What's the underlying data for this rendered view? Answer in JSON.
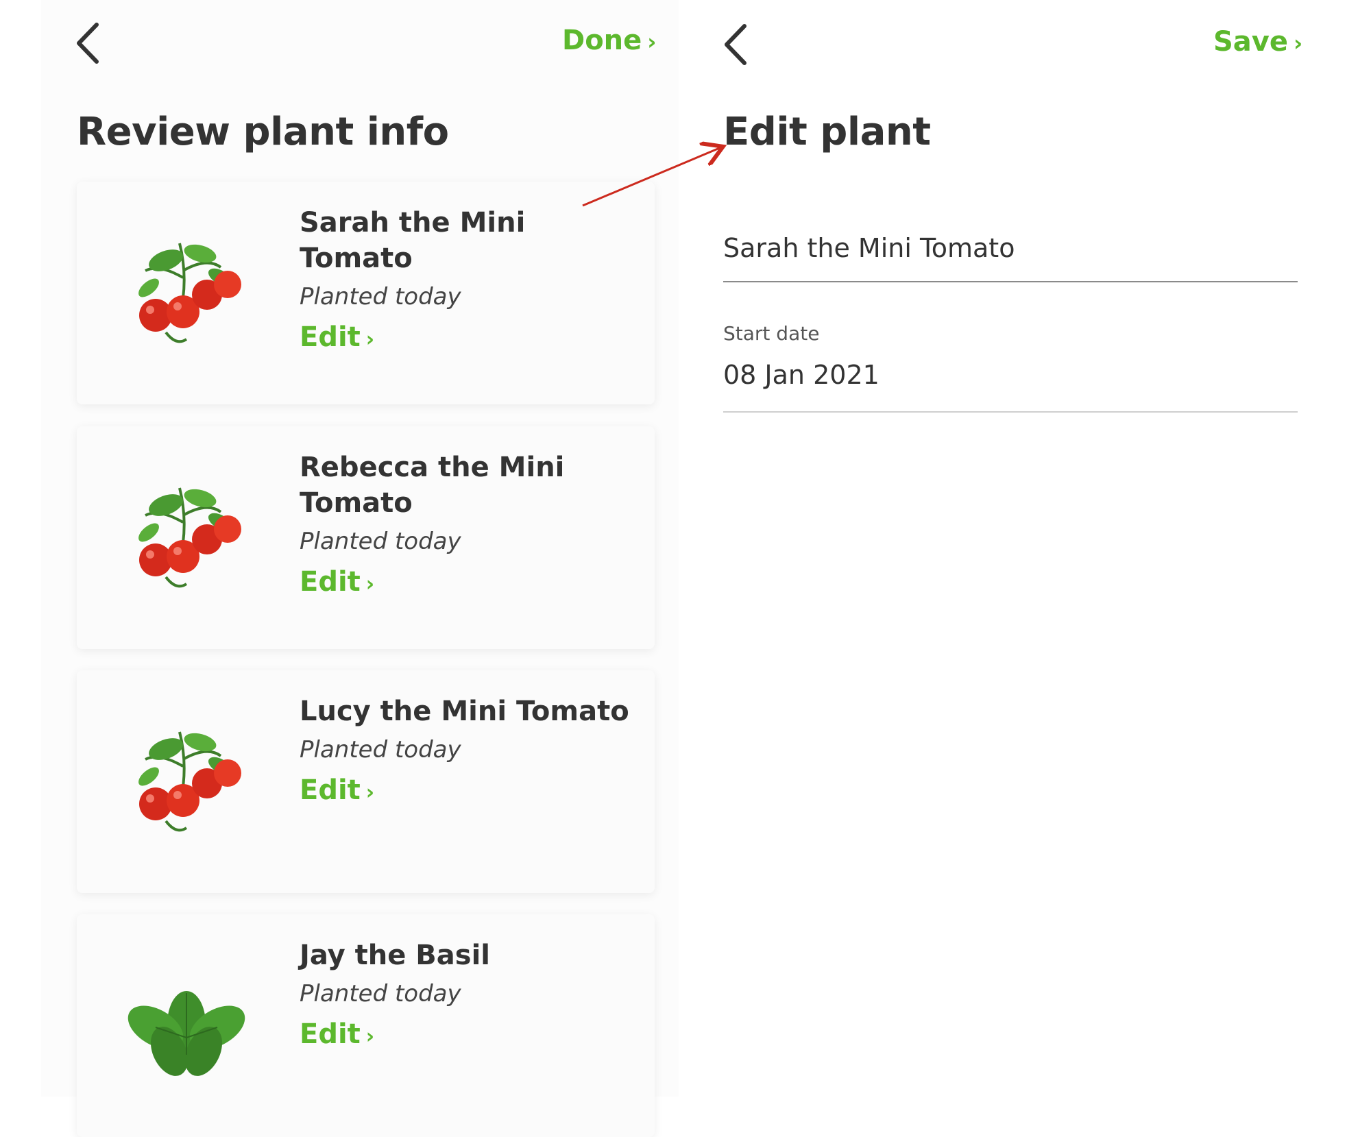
{
  "left_screen": {
    "back_icon": "chevron-left-icon",
    "done_label": "Done",
    "chevron": "›",
    "title": "Review plant info",
    "plants": [
      {
        "name": "Sarah the Mini Tomato",
        "status": "Planted today",
        "edit_label": "Edit",
        "icon": "tomato-plant"
      },
      {
        "name": "Rebecca the Mini Tomato",
        "status": "Planted today",
        "edit_label": "Edit",
        "icon": "tomato-plant"
      },
      {
        "name": "Lucy the Mini Tomato",
        "status": "Planted today",
        "edit_label": "Edit",
        "icon": "tomato-plant"
      },
      {
        "name": "Jay the Basil",
        "status": "Planted today",
        "edit_label": "Edit",
        "icon": "basil-plant"
      }
    ]
  },
  "right_screen": {
    "back_icon": "chevron-left-icon",
    "save_label": "Save",
    "chevron": "›",
    "title": "Edit plant",
    "name_value": "Sarah the Mini Tomato",
    "start_date_label": "Start date",
    "start_date_value": "08 Jan 2021"
  },
  "colors": {
    "accent_green": "#5cb82d",
    "text_dark": "#333333",
    "annotation_arrow": "#cc2a1e"
  }
}
